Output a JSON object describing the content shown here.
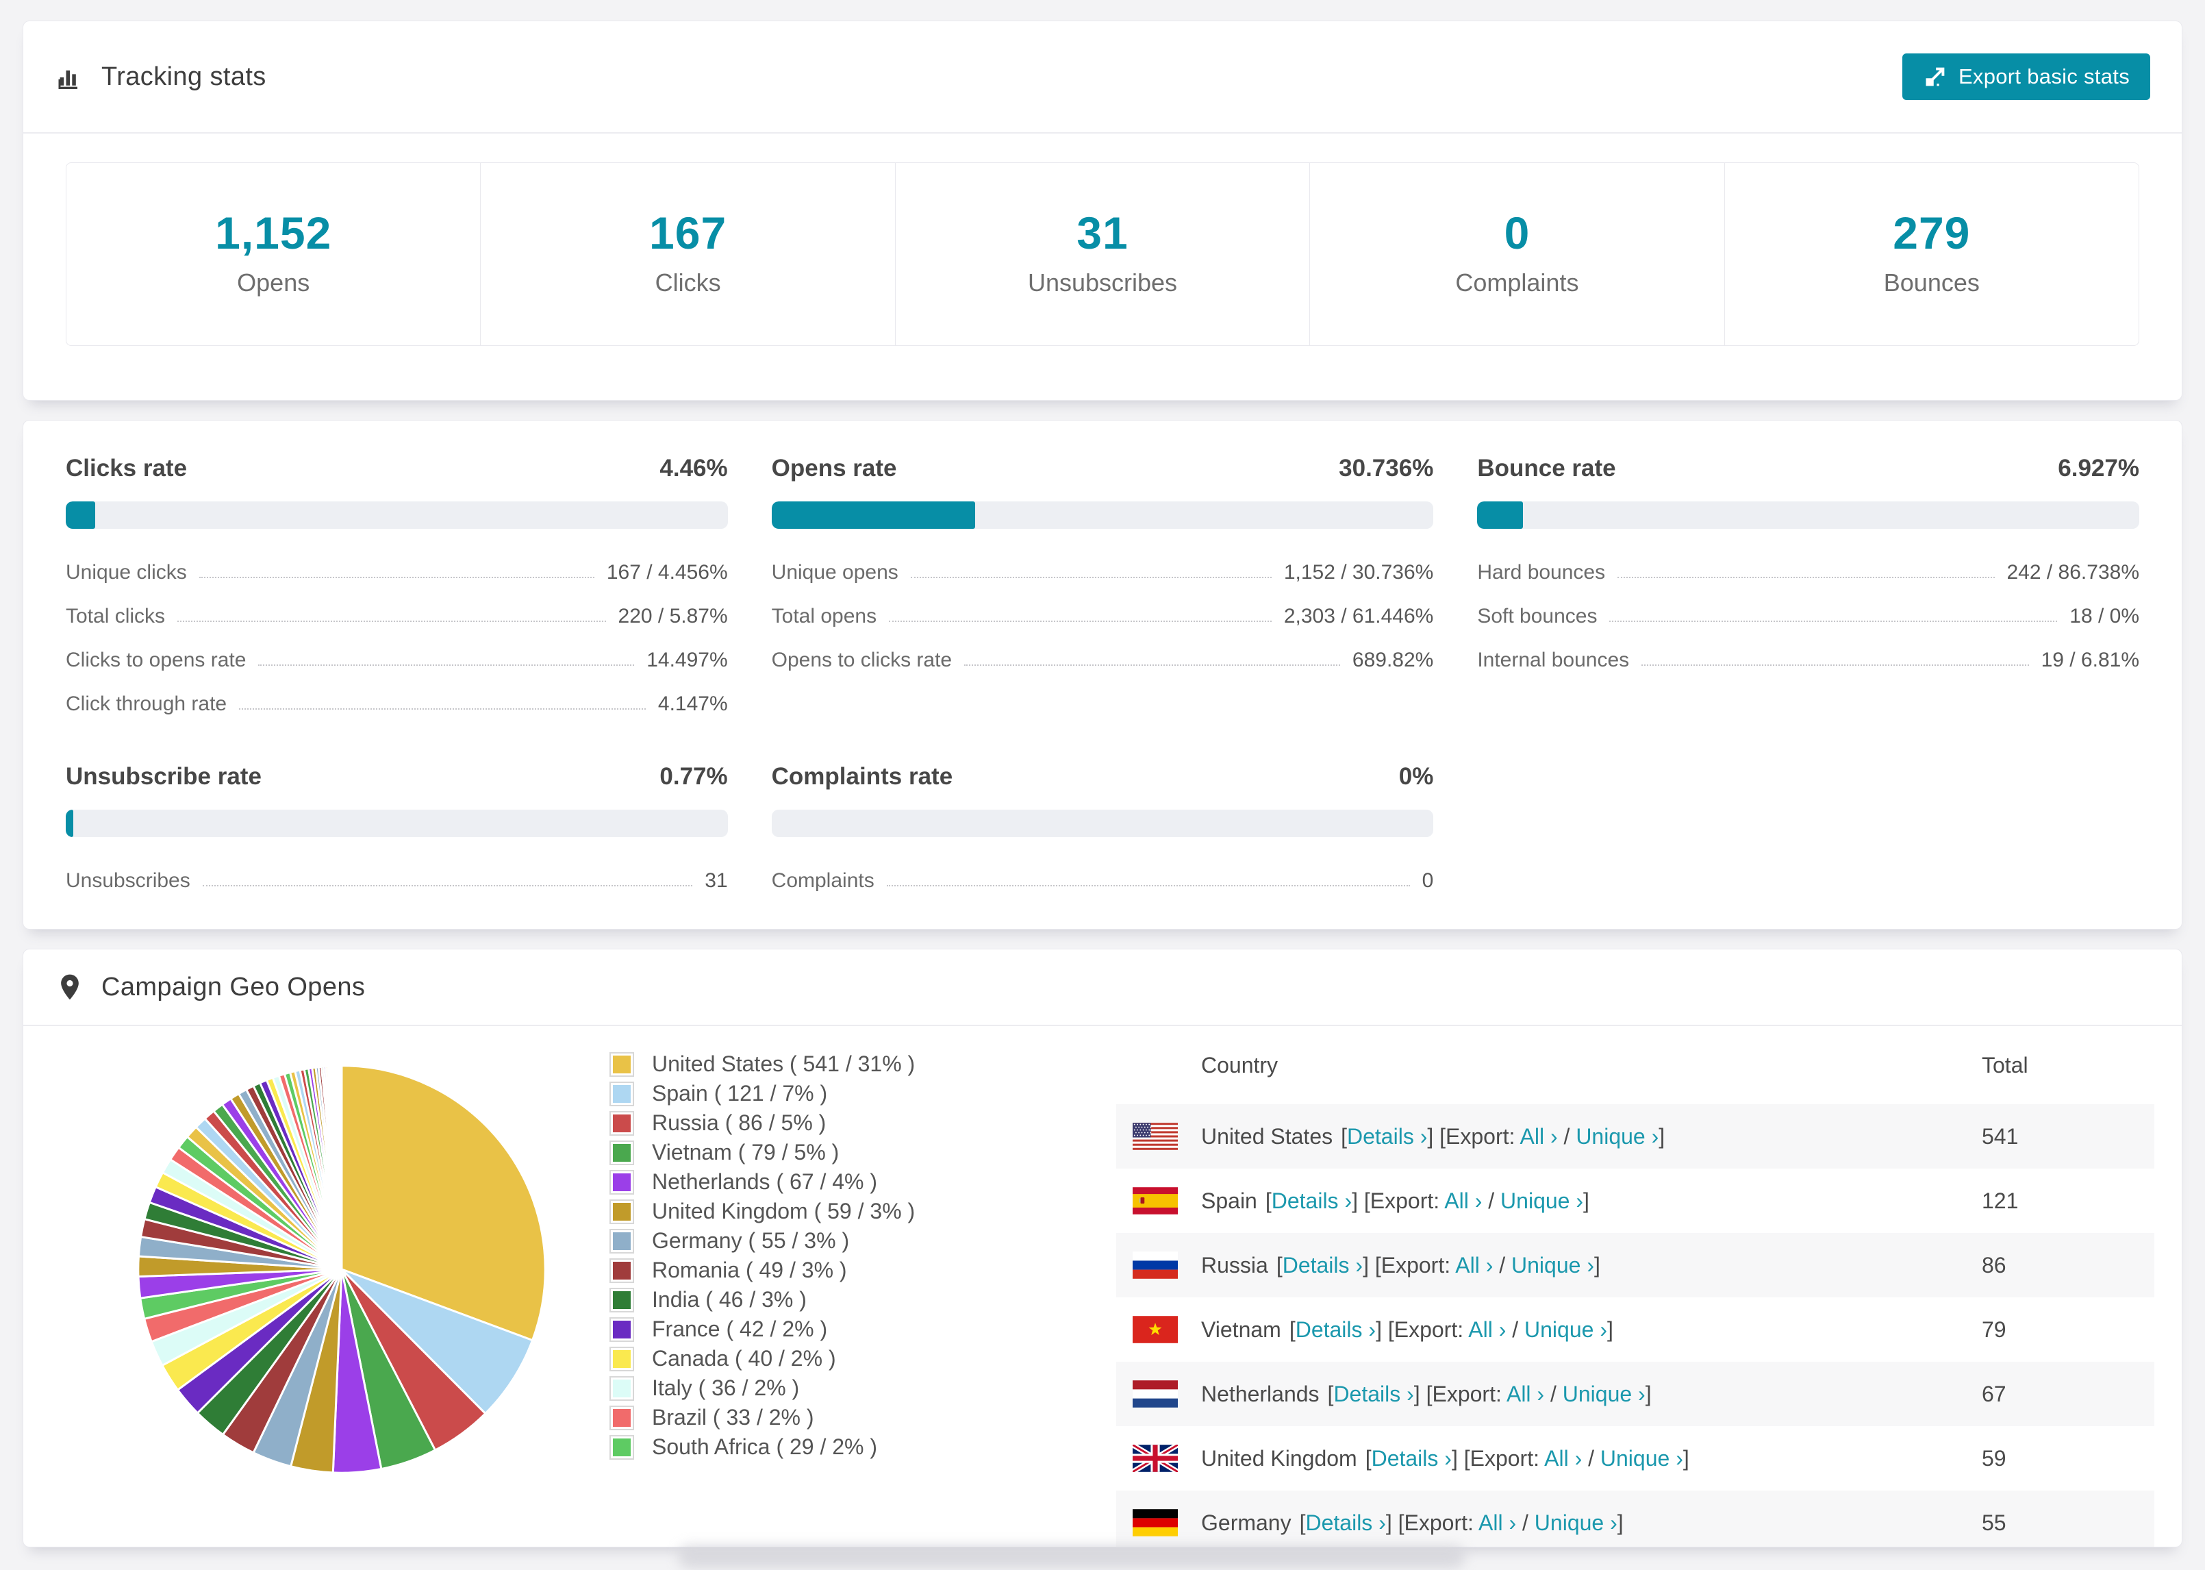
{
  "header": {
    "title": "Tracking stats",
    "export_label": "Export basic stats",
    "title_icon": "bar-chart-icon",
    "export_icon": "export-icon"
  },
  "summary": {
    "items": [
      {
        "value": "1,152",
        "label": "Opens"
      },
      {
        "value": "167",
        "label": "Clicks"
      },
      {
        "value": "31",
        "label": "Unsubscribes"
      },
      {
        "value": "0",
        "label": "Complaints"
      },
      {
        "value": "279",
        "label": "Bounces"
      }
    ]
  },
  "rates": {
    "blocks": [
      {
        "title": "Clicks rate",
        "value": "4.46%",
        "bar_percent": 4.46,
        "rows": [
          {
            "label": "Unique clicks",
            "value": "167 / 4.456%"
          },
          {
            "label": "Total clicks",
            "value": "220 / 5.87%"
          },
          {
            "label": "Clicks to opens rate",
            "value": "14.497%"
          },
          {
            "label": "Click through rate",
            "value": "4.147%"
          }
        ]
      },
      {
        "title": "Opens rate",
        "value": "30.736%",
        "bar_percent": 30.736,
        "rows": [
          {
            "label": "Unique opens",
            "value": "1,152 / 30.736%"
          },
          {
            "label": "Total opens",
            "value": "2,303 / 61.446%"
          },
          {
            "label": "Opens to clicks rate",
            "value": "689.82%"
          }
        ]
      },
      {
        "title": "Bounce rate",
        "value": "6.927%",
        "bar_percent": 6.927,
        "rows": [
          {
            "label": "Hard bounces",
            "value": "242 / 86.738%"
          },
          {
            "label": "Soft bounces",
            "value": "18 / 0%"
          },
          {
            "label": "Internal bounces",
            "value": "19 / 6.81%"
          }
        ]
      },
      {
        "title": "Unsubscribe rate",
        "value": "0.77%",
        "bar_percent": 0.77,
        "rows": [
          {
            "label": "Unsubscribes",
            "value": "31"
          }
        ]
      },
      {
        "title": "Complaints rate",
        "value": "0%",
        "bar_percent": 0,
        "rows": [
          {
            "label": "Complaints",
            "value": "0"
          }
        ]
      }
    ]
  },
  "geo": {
    "title": "Campaign Geo Opens",
    "title_icon": "location-pin-icon",
    "legend": [
      {
        "name": "United States",
        "value": 541,
        "pct": 31,
        "color": "#e9c247"
      },
      {
        "name": "Spain",
        "value": 121,
        "pct": 7,
        "color": "#aed7f2"
      },
      {
        "name": "Russia",
        "value": 86,
        "pct": 5,
        "color": "#cb4b4b"
      },
      {
        "name": "Vietnam",
        "value": 79,
        "pct": 5,
        "color": "#4aa84e"
      },
      {
        "name": "Netherlands",
        "value": 67,
        "pct": 4,
        "color": "#9b3fe8"
      },
      {
        "name": "United Kingdom",
        "value": 59,
        "pct": 3,
        "color": "#c19b2a"
      },
      {
        "name": "Germany",
        "value": 55,
        "pct": 3,
        "color": "#8fafc9"
      },
      {
        "name": "Romania",
        "value": 49,
        "pct": 3,
        "color": "#a03c3c"
      },
      {
        "name": "India",
        "value": 46,
        "pct": 3,
        "color": "#2f7d36"
      },
      {
        "name": "France",
        "value": 42,
        "pct": 2,
        "color": "#6a2bc2"
      },
      {
        "name": "Canada",
        "value": 40,
        "pct": 2,
        "color": "#fae94f"
      },
      {
        "name": "Italy",
        "value": 36,
        "pct": 2,
        "color": "#dcfcf7"
      },
      {
        "name": "Brazil",
        "value": 33,
        "pct": 2,
        "color": "#f16b6b"
      },
      {
        "name": "South Africa",
        "value": 29,
        "pct": 2,
        "color": "#5ecb63"
      }
    ],
    "others_values": [
      30,
      28,
      27,
      25,
      24,
      23,
      22,
      21,
      20,
      19,
      18,
      17,
      16,
      15,
      14,
      13,
      12,
      11,
      10,
      10,
      9,
      9,
      8,
      8,
      7,
      7,
      6,
      6,
      5,
      5,
      4,
      4,
      3,
      3,
      3,
      2,
      2,
      2,
      2,
      1,
      1,
      1,
      1,
      1,
      1,
      1,
      1,
      1,
      1,
      1
    ],
    "table": {
      "headers": [
        "Country",
        "Total"
      ],
      "links": {
        "details": "Details",
        "export": "Export:",
        "all": "All",
        "unique": "Unique",
        "arrow": "›"
      },
      "rows": [
        {
          "country": "United States",
          "flag": "us",
          "total": "541"
        },
        {
          "country": "Spain",
          "flag": "es",
          "total": "121"
        },
        {
          "country": "Russia",
          "flag": "ru",
          "total": "86"
        },
        {
          "country": "Vietnam",
          "flag": "vn",
          "total": "79"
        },
        {
          "country": "Netherlands",
          "flag": "nl",
          "total": "67"
        },
        {
          "country": "United Kingdom",
          "flag": "gb",
          "total": "59"
        },
        {
          "country": "Germany",
          "flag": "de",
          "total": "55"
        }
      ]
    }
  },
  "chart_data": {
    "type": "pie",
    "title": "Campaign Geo Opens",
    "categories": [
      "United States",
      "Spain",
      "Russia",
      "Vietnam",
      "Netherlands",
      "United Kingdom",
      "Germany",
      "Romania",
      "India",
      "France",
      "Canada",
      "Italy",
      "Brazil",
      "South Africa"
    ],
    "values": [
      541,
      121,
      86,
      79,
      67,
      59,
      55,
      49,
      46,
      42,
      40,
      36,
      33,
      29
    ],
    "percents": [
      31,
      7,
      5,
      5,
      4,
      3,
      3,
      3,
      3,
      2,
      2,
      2,
      2,
      2
    ],
    "legend_position": "right",
    "note_others_slices_sum_approx": 481
  },
  "colors": {
    "teal": "#078ea6",
    "link": "#1b98ad",
    "bar_track": "#edeff3",
    "row_alt": "#f7f7f8"
  }
}
